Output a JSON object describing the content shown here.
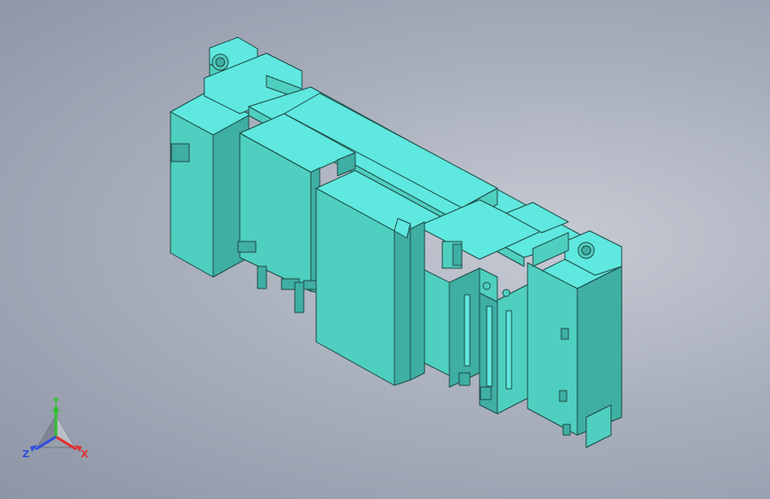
{
  "viewport": {
    "background_top": "#8d95a6",
    "background_center": "#c6cad4"
  },
  "model": {
    "body_color": "#5fe8df",
    "shade_color": "#4fcfbf",
    "dark_color": "#3faea3",
    "edge_color": "#1f4d48"
  },
  "triad": {
    "x_label": "X",
    "y_label": "Y",
    "z_label": "Z",
    "x_color": "#e03030",
    "y_color": "#30c030",
    "z_color": "#3050e0",
    "icon": "view-orientation-triad-icon"
  }
}
